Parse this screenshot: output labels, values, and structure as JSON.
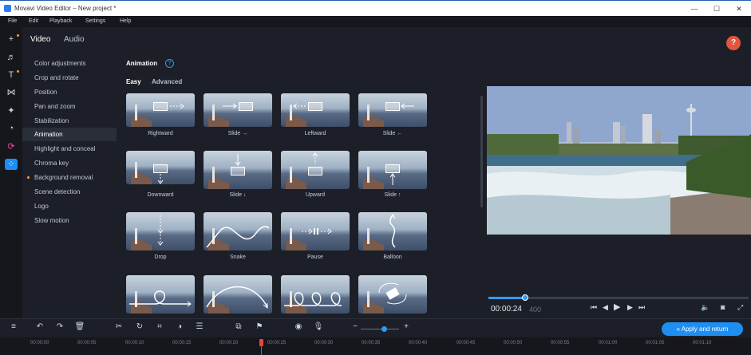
{
  "window": {
    "title": "Movavi Video Editor – New project *",
    "minimize": "—",
    "maximize": "☐",
    "close": "✕"
  },
  "menu": [
    "File",
    "Edit",
    "Playback",
    "Settings",
    "Help"
  ],
  "tabs": {
    "video": "Video",
    "audio": "Audio"
  },
  "categories": [
    "Color adjustments",
    "Crop and rotate",
    "Position",
    "Pan and zoom",
    "Stabilization",
    "Animation",
    "Highlight and conceal",
    "Chroma key",
    "Background removal",
    "Scene detection",
    "Logo",
    "Slow motion"
  ],
  "selected_category": "Animation",
  "section": {
    "title": "Animation",
    "help": "?"
  },
  "modes": {
    "easy": "Easy",
    "advanced": "Advanced"
  },
  "animations": [
    "Rightward",
    "Slide →",
    "Leftward",
    "Slide ←",
    "Downward",
    "Slide ↓",
    "Upward",
    "Slide ↑",
    "Drop",
    "Snake",
    "Pause",
    "Balloon"
  ],
  "help_button": "?",
  "player": {
    "timecode": "00:00:24",
    "timecode_frac": "400",
    "progress": 0.14
  },
  "apply_button": "« Apply and return",
  "ruler": [
    "00:00:00",
    "00:00:05",
    "00:00:10",
    "00:00:15",
    "00:00:20",
    "00:00:25",
    "00:00:30",
    "00:00:35",
    "00:00:40",
    "00:00:45",
    "00:00:50",
    "00:00:55",
    "00:01:00",
    "00:01:05",
    "00:01:10"
  ],
  "colors": {
    "accent": "#1f8ef1",
    "help": "#e2553f",
    "playhead": "#e8453c"
  }
}
